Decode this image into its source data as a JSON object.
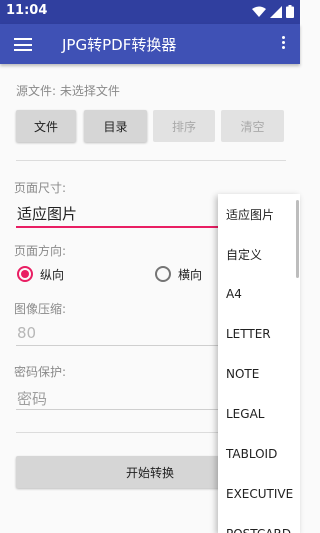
{
  "status_bar": {
    "time": "11:04"
  },
  "app_bar": {
    "title": "JPG转PDF转换器"
  },
  "source": {
    "label": "源文件: 未选择文件",
    "buttons": [
      "文件",
      "目录",
      "排序",
      "清空"
    ]
  },
  "page_size": {
    "label": "页面尺寸:",
    "value": "适应图片"
  },
  "orientation": {
    "label": "页面方向:",
    "portrait": "纵向",
    "landscape": "横向"
  },
  "compression": {
    "label": "图像压缩:",
    "placeholder": "80"
  },
  "password": {
    "label": "密码保护:",
    "placeholder": "密码"
  },
  "start_button": "开始转换",
  "dropdown": {
    "items": [
      "适应图片",
      "自定义",
      "A4",
      "LETTER",
      "NOTE",
      "LEGAL",
      "TABLOID",
      "EXECUTIVE",
      "POSTCARD"
    ]
  },
  "colors": {
    "primary": "#3F51B5",
    "primary_dark": "#303F9F",
    "accent": "#E91E63"
  }
}
